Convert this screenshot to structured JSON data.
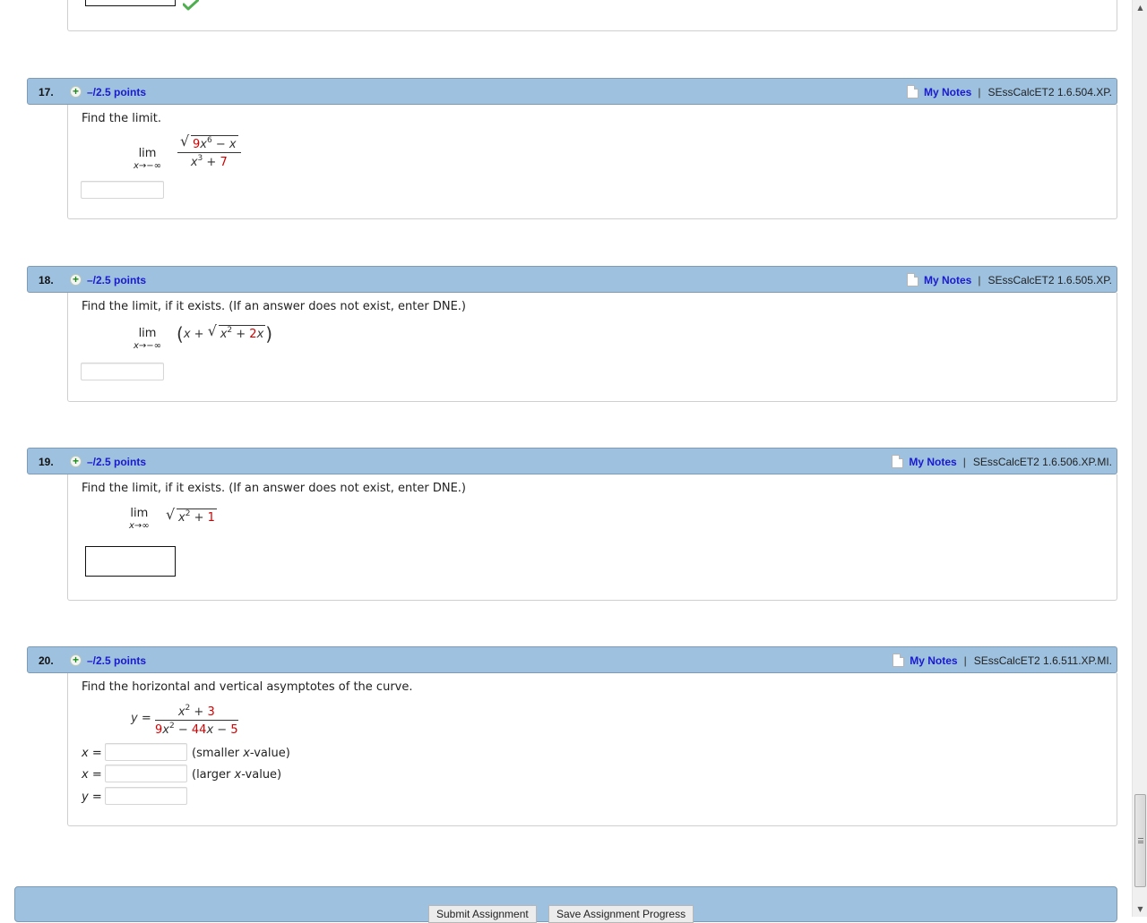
{
  "previous": {
    "status_icon": "check-icon"
  },
  "questions": [
    {
      "number": "17.",
      "points": "–/2.5 points",
      "notes_label": "My Notes",
      "separator": "|",
      "code": "SEssCalcET2 1.6.504.XP.",
      "prompt": "Find the limit.",
      "math": {
        "lim": "lim",
        "sub": "x→−∞",
        "num_coef": "9",
        "num_x": "x",
        "num_exp": "6",
        "num_rest": " − x",
        "den_x": "x",
        "den_exp": "3",
        "den_plus": " + ",
        "den_const": "7"
      },
      "answer": ""
    },
    {
      "number": "18.",
      "points": "–/2.5 points",
      "notes_label": "My Notes",
      "separator": "|",
      "code": "SEssCalcET2 1.6.505.XP.",
      "prompt": "Find the limit, if it exists. (If an answer does not exist, enter DNE.)",
      "math": {
        "lim": "lim",
        "sub": "x→−∞",
        "open": "(",
        "x": "x",
        "plus": " + ",
        "inner_x": "x",
        "inner_exp": "2",
        "inner_plus": " + ",
        "inner_coef": "2",
        "inner_x2": "x",
        "close": ")"
      },
      "answer": ""
    },
    {
      "number": "19.",
      "points": "–/2.5 points",
      "notes_label": "My Notes",
      "separator": "|",
      "code": "SEssCalcET2 1.6.506.XP.MI.",
      "prompt": "Find the limit, if it exists. (If an answer does not exist, enter DNE.)",
      "math": {
        "lim": "lim",
        "sub": "x→∞",
        "inner_x": "x",
        "inner_exp": "2",
        "inner_plus": " + ",
        "inner_const": "1"
      },
      "answer": ""
    },
    {
      "number": "20.",
      "points": "–/2.5 points",
      "notes_label": "My Notes",
      "separator": "|",
      "code": "SEssCalcET2 1.6.511.XP.MI.",
      "prompt": "Find the horizontal and vertical asymptotes of the curve.",
      "math": {
        "lhs": "y =",
        "num_x": "x",
        "num_exp": "2",
        "num_plus": " + ",
        "num_const": "3",
        "den_coef": "9",
        "den_x": "x",
        "den_exp": "2",
        "den_minus1": " − ",
        "den_coef2": "44",
        "den_x2": "x",
        "den_minus2": " − ",
        "den_const": "5"
      },
      "rows": [
        {
          "label": "x =",
          "value": "",
          "hint_pre": "(smaller ",
          "hint_var": "x",
          "hint_post": "-value)"
        },
        {
          "label": "x =",
          "value": "",
          "hint_pre": "(larger ",
          "hint_var": "x",
          "hint_post": "-value)"
        },
        {
          "label": "y =",
          "value": "",
          "hint_pre": "",
          "hint_var": "",
          "hint_post": ""
        }
      ]
    }
  ],
  "footer": {
    "submit_label": "Submit Assignment",
    "save_label": "Save Assignment Progress"
  },
  "scrollbar": {
    "up": "▲",
    "down": "▼"
  }
}
